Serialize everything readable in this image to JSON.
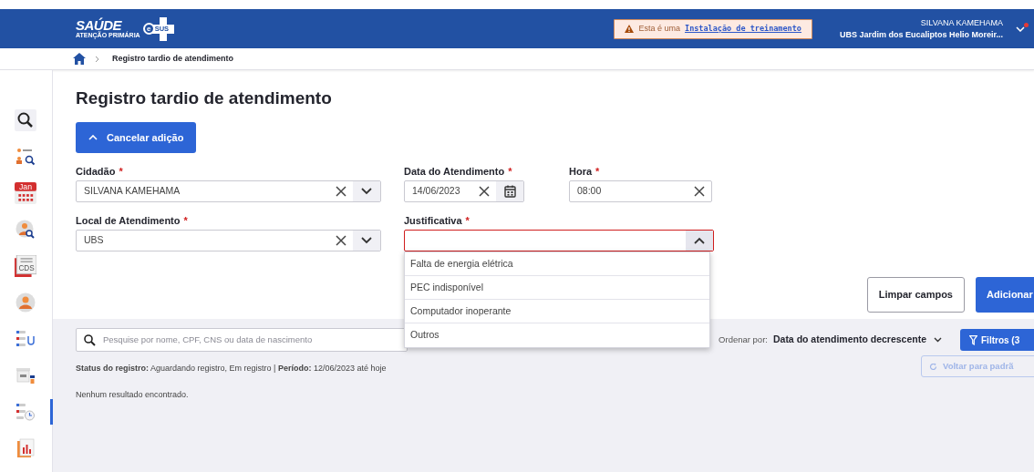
{
  "header": {
    "logo": {
      "title": "SAÚDE",
      "subtitle": "ATENÇÃO PRIMÁRIA",
      "badge_e": "e",
      "badge_sus": "SUS"
    },
    "notice": {
      "text": "Esta é uma",
      "link": "Instalação de treinamento"
    },
    "user": {
      "name": "SILVANA KAMEHAMA",
      "unit": "UBS Jardim dos Eucaliptos Helio Moreir...",
      "has_notification": true
    }
  },
  "breadcrumb": [
    {
      "label": "Registro tardio de atendimento"
    }
  ],
  "sidebar": {
    "items": [
      {
        "kind": "search",
        "selected": false
      },
      {
        "kind": "people-search",
        "selected": false
      },
      {
        "kind": "calendar",
        "label": "Jan",
        "selected": false
      },
      {
        "kind": "person-search",
        "selected": false
      },
      {
        "kind": "document",
        "label": "CDS",
        "selected": false
      },
      {
        "kind": "person",
        "selected": false
      },
      {
        "kind": "list-stethoscope",
        "selected": false
      },
      {
        "kind": "box",
        "selected": false
      },
      {
        "kind": "list-clock",
        "selected": true
      },
      {
        "kind": "report",
        "selected": false
      }
    ]
  },
  "page": {
    "title": "Registro tardio de atendimento",
    "cancel_button": "Cancelar adição",
    "rows": [
      [
        {
          "label": "Cidadão",
          "required_mark": "*",
          "kind": "select",
          "value": "SILVANA KAMEHAMA",
          "expanded": false,
          "invalid": false
        },
        {
          "label": "Data do Atendimento",
          "required_mark": "*",
          "kind": "date",
          "value": "14/06/2023",
          "invalid": false
        },
        {
          "label": "Hora",
          "required_mark": "*",
          "kind": "text",
          "value": "08:00",
          "invalid": false
        }
      ],
      [
        {
          "label": "Local de Atendimento",
          "required_mark": "*",
          "kind": "select",
          "value": "UBS",
          "expanded": false,
          "invalid": false
        },
        {
          "label": "Justificativa",
          "required_mark": "*",
          "kind": "select",
          "expanded": true,
          "invalid": true,
          "options": [
            "Falta de energia elétrica",
            "PEC indisponível",
            "Computador inoperante",
            "Outros"
          ]
        }
      ]
    ],
    "actions": [
      {
        "label": "Limpar campos",
        "kind": "secondary"
      },
      {
        "label": "Adicionar",
        "kind": "primary"
      }
    ]
  },
  "list": {
    "search_placeholder": "Pesquise por nome, CPF, CNS ou data de nascimento",
    "sort_label": "Ordenar por:",
    "sort_value": "Data do atendimento decrescente",
    "filters_button": "Filtros (3",
    "reset_button": {
      "label": "Voltar para padrã",
      "disabled": true
    },
    "status": "**Status do registro:** Aguardando registro, Em registro | **Período:** 12/06/2023 até hoje",
    "empty": "Nenhum resultado encontrado."
  }
}
